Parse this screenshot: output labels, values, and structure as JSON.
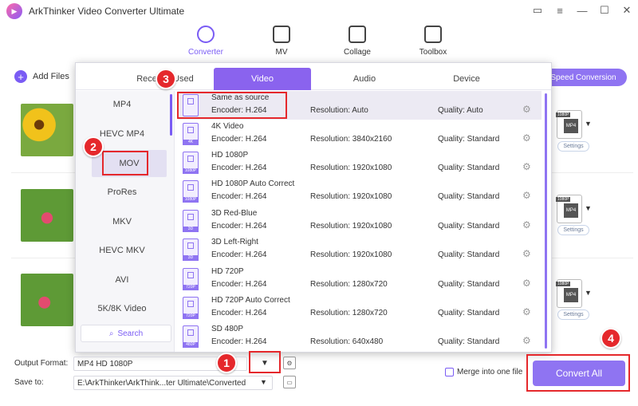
{
  "app": {
    "title": "ArkThinker Video Converter Ultimate"
  },
  "window_controls": [
    "chat-icon",
    "menu-icon",
    "minimize-icon",
    "maximize-icon",
    "close-icon"
  ],
  "nav": [
    {
      "label": "Converter",
      "icon": "converter-icon",
      "active": true
    },
    {
      "label": "MV",
      "icon": "mv-icon"
    },
    {
      "label": "Collage",
      "icon": "collage-icon"
    },
    {
      "label": "Toolbox",
      "icon": "toolbox-icon"
    }
  ],
  "toolbar": {
    "add_files": "Add Files",
    "high_speed": "h Speed Conversion"
  },
  "files": [
    {
      "format_badge": "MP4",
      "format_tag": "1080P",
      "settings": "Settings"
    },
    {
      "format_badge": "MP4",
      "format_tag": "1080P",
      "settings": "Settings"
    },
    {
      "format_badge": "MP4",
      "format_tag": "1080P",
      "settings": "Settings"
    }
  ],
  "popup": {
    "tabs": [
      {
        "label": "Recently Used",
        "active": false
      },
      {
        "label": "Video",
        "active": true
      },
      {
        "label": "Audio",
        "active": false
      },
      {
        "label": "Device",
        "active": false
      }
    ],
    "categories": [
      "MP4",
      "HEVC MP4",
      "MOV",
      "ProRes",
      "MKV",
      "HEVC MKV",
      "AVI",
      "5K/8K Video"
    ],
    "selected_category": "MOV",
    "search_label": "Search",
    "presets": [
      {
        "name": "Same as source",
        "encoder": "Encoder: H.264",
        "resolution": "Resolution: Auto",
        "quality": "Quality: Auto",
        "icon_label": ""
      },
      {
        "name": "4K Video",
        "encoder": "Encoder: H.264",
        "resolution": "Resolution: 3840x2160",
        "quality": "Quality: Standard",
        "icon_label": "4K"
      },
      {
        "name": "HD 1080P",
        "encoder": "Encoder: H.264",
        "resolution": "Resolution: 1920x1080",
        "quality": "Quality: Standard",
        "icon_label": "1080P"
      },
      {
        "name": "HD 1080P Auto Correct",
        "encoder": "Encoder: H.264",
        "resolution": "Resolution: 1920x1080",
        "quality": "Quality: Standard",
        "icon_label": "1080P"
      },
      {
        "name": "3D Red-Blue",
        "encoder": "Encoder: H.264",
        "resolution": "Resolution: 1920x1080",
        "quality": "Quality: Standard",
        "icon_label": "3D"
      },
      {
        "name": "3D Left-Right",
        "encoder": "Encoder: H.264",
        "resolution": "Resolution: 1920x1080",
        "quality": "Quality: Standard",
        "icon_label": "3D"
      },
      {
        "name": "HD 720P",
        "encoder": "Encoder: H.264",
        "resolution": "Resolution: 1280x720",
        "quality": "Quality: Standard",
        "icon_label": "720P"
      },
      {
        "name": "HD 720P Auto Correct",
        "encoder": "Encoder: H.264",
        "resolution": "Resolution: 1280x720",
        "quality": "Quality: Standard",
        "icon_label": "720P"
      },
      {
        "name": "SD 480P",
        "encoder": "Encoder: H.264",
        "resolution": "Resolution: 640x480",
        "quality": "Quality: Standard",
        "icon_label": "480P"
      }
    ]
  },
  "bottom": {
    "output_format_label": "Output Format:",
    "output_format_value": "MP4 HD 1080P",
    "save_to_label": "Save to:",
    "save_to_value": "E:\\ArkThinker\\ArkThink...ter Ultimate\\Converted",
    "merge_label": "Merge into one file",
    "convert_all": "Convert All"
  },
  "annotations": {
    "step1": "1",
    "step2": "2",
    "step3": "3",
    "step4": "4"
  },
  "colors": {
    "accent": "#8f74f2",
    "annotation_red": "#e5282c"
  }
}
